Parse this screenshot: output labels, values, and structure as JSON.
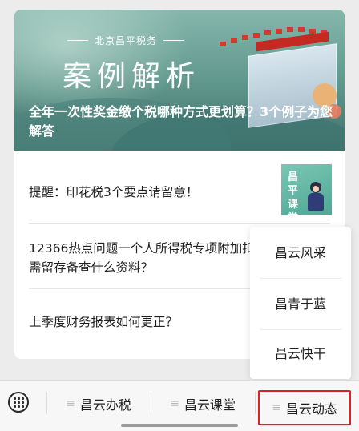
{
  "banner": {
    "brand": "北京昌平税务",
    "title": "案例解析",
    "headline": "全年一次性奖金缴个税哪种方式更划算？3个例子为您解答"
  },
  "articles": [
    {
      "title": "提醒：印花税3个要点请留意！"
    },
    {
      "title": "12366热点问题一个人所得税专项附加扣除需留存备查什么资料？"
    },
    {
      "title": "上季度财务报表如何更正？"
    }
  ],
  "thumb": {
    "text": "昌平课堂"
  },
  "popup_menu": {
    "items": [
      "昌云风采",
      "昌青于蓝",
      "昌云快干"
    ]
  },
  "bottom_menu": {
    "tabs": [
      {
        "label": "昌云办税",
        "active": false
      },
      {
        "label": "昌云课堂",
        "active": false
      },
      {
        "label": "昌云动态",
        "active": true
      }
    ],
    "menu_icon": "≡",
    "keyboard_icon": "keyboard-icon",
    "highlight_color": "#e02020"
  }
}
